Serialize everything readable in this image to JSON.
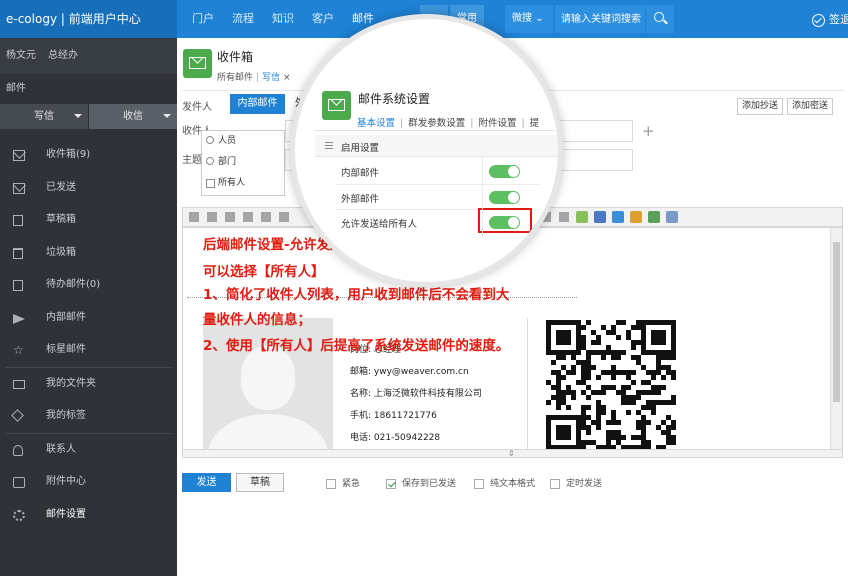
{
  "app": {
    "logo": "e-cology | 前端用户中心"
  },
  "topnav": {
    "items": [
      "门户",
      "流程",
      "知识",
      "客户",
      "邮件"
    ],
    "common": "常用",
    "weisou": "微搜",
    "search_placeholder": "请输入关键词搜索",
    "signin": "签退"
  },
  "sidebar": {
    "user_name": "杨文元",
    "user_role": "总经办",
    "section": "邮件",
    "write": "写信",
    "receive": "收信",
    "items": [
      {
        "label": "收件箱(9)",
        "icon": "inbox-icon"
      },
      {
        "label": "已发送",
        "icon": "sent-icon"
      },
      {
        "label": "草稿箱",
        "icon": "draft-icon"
      },
      {
        "label": "垃圾箱",
        "icon": "trash-icon"
      },
      {
        "label": "待办邮件(0)",
        "icon": "todo-icon"
      },
      {
        "label": "内部邮件",
        "icon": "paper-plane-icon"
      },
      {
        "label": "标星邮件",
        "icon": "star-icon"
      },
      {
        "label": "我的文件夹",
        "icon": "folder-icon"
      },
      {
        "label": "我的标签",
        "icon": "tag-icon"
      },
      {
        "label": "联系人",
        "icon": "contact-icon"
      },
      {
        "label": "附件中心",
        "icon": "attachment-icon"
      },
      {
        "label": "邮件设置",
        "icon": "gear-icon"
      }
    ]
  },
  "header": {
    "title": "收件箱",
    "tab_all": "所有邮件",
    "tab_write": "写信",
    "tab_close": "×"
  },
  "compose": {
    "sender_label": "发件人",
    "tab_internal": "内部邮件",
    "tab_external": "外",
    "recipient_label": "收件人",
    "subject_label": "主题",
    "add_cc": "添加抄送",
    "add_bcc": "添加密送",
    "plus": "+",
    "dropdown": [
      "人员",
      "部门",
      "所有人"
    ]
  },
  "card": {
    "title_line": "岗位: 总经理",
    "email_line": "邮箱: ywy@weaver.com.cn",
    "company_line": "名称: 上海泛微软件科技有限公司",
    "mobile_line": "手机: 18611721776",
    "phone_line": "电话: 021-50942228"
  },
  "annotation": {
    "line1": "后端邮件设置-允许发送给所有人开启后，内部邮件",
    "line2": "可以选择【所有人】",
    "line3": "1、简化了收件人列表，用户收到邮件后不会看到大",
    "line4": "量收件人的信息；",
    "line5": "2、使用【所有人】后提高了系统发送邮件的速度。",
    "color": "#e11b0f"
  },
  "footer": {
    "send": "发送",
    "draft": "草稿",
    "options": [
      {
        "label": "紧急",
        "checked": false
      },
      {
        "label": "保存到已发送",
        "checked": true
      },
      {
        "label": "纯文本格式",
        "checked": false
      },
      {
        "label": "定时发送",
        "checked": false
      }
    ]
  },
  "settings": {
    "title": "邮件系统设置",
    "tabs": [
      "基本设置",
      "群发参数设置",
      "附件设置",
      "提"
    ],
    "section": "启用设置",
    "rows": [
      {
        "label": "内部邮件",
        "enabled": true
      },
      {
        "label": "外部邮件",
        "enabled": true
      },
      {
        "label": "允许发送给所有人",
        "enabled": true
      }
    ]
  },
  "colors": {
    "accent": "#1f82d4",
    "sidebar": "#2f3338",
    "toggle_on": "#5cbf62",
    "icon_green": "#4caa4c"
  }
}
